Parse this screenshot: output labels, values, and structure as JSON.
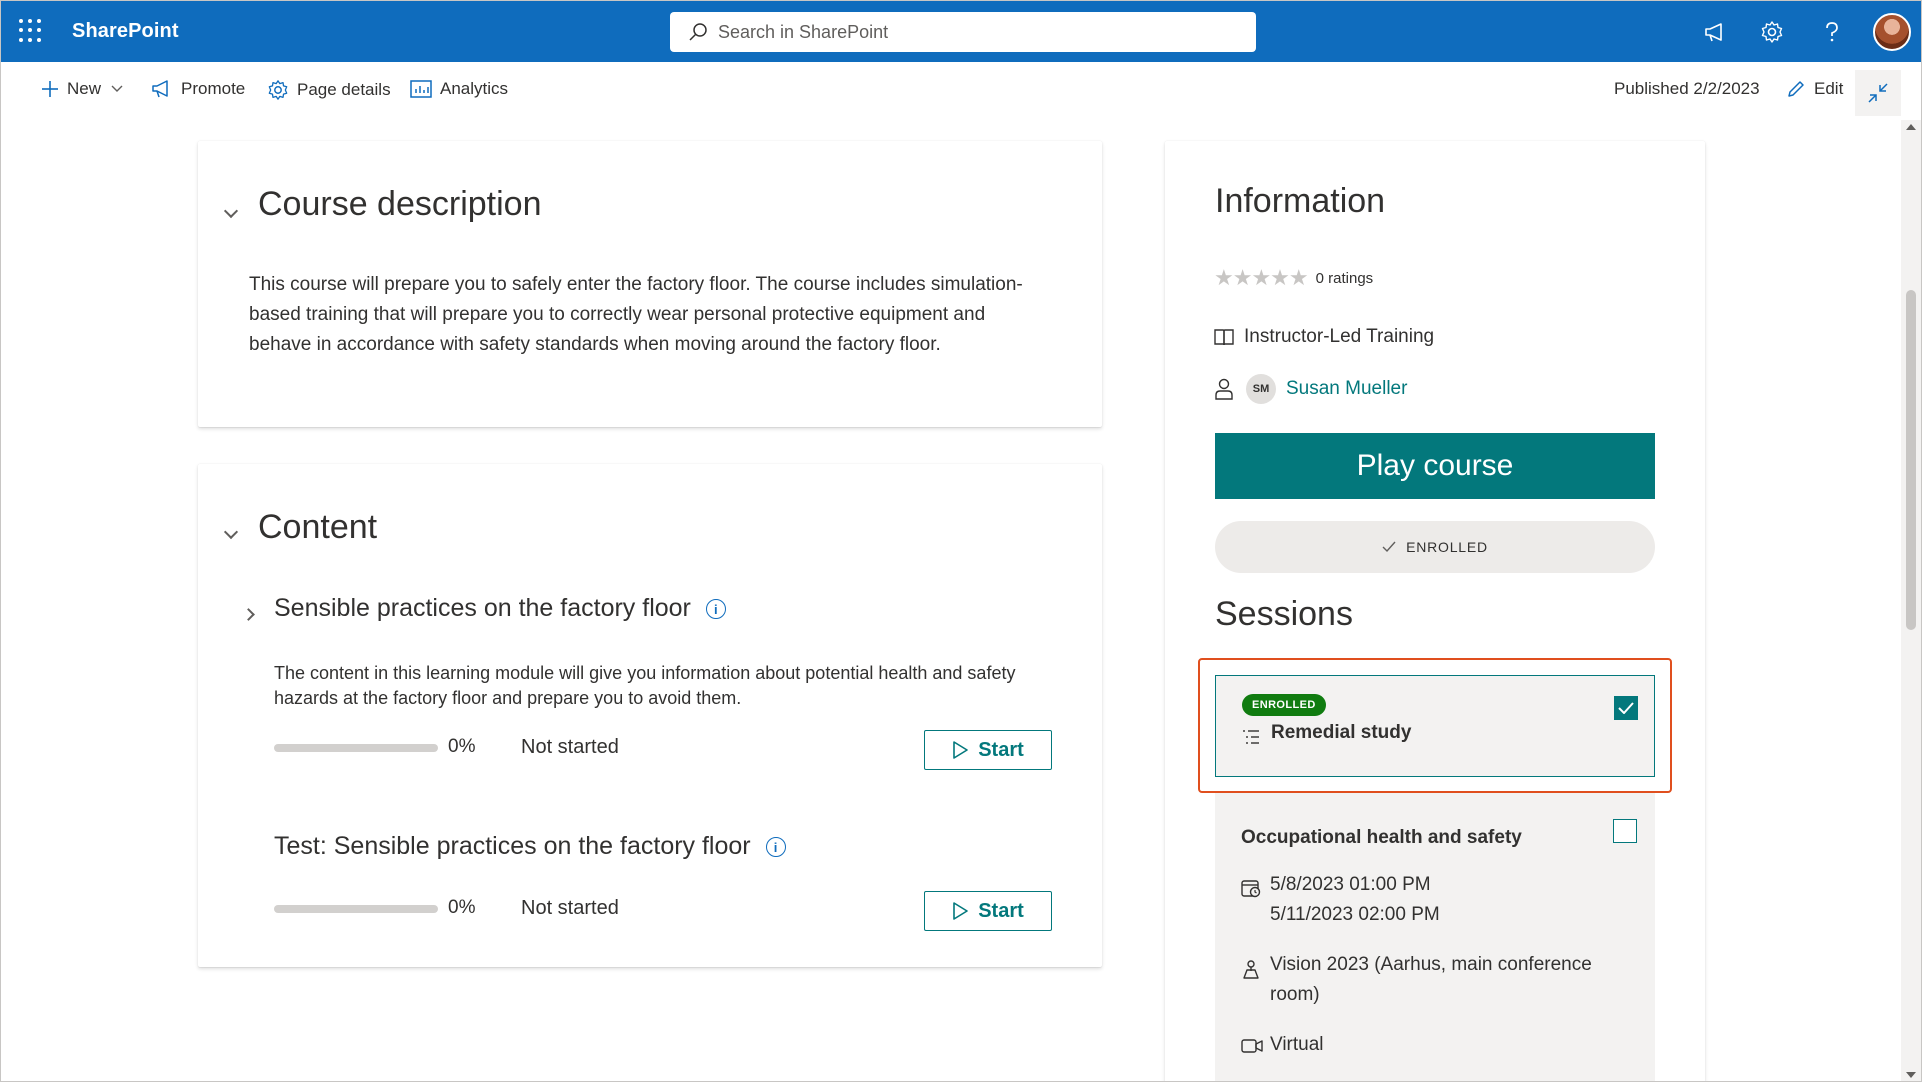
{
  "suitebar": {
    "app_name": "SharePoint",
    "search_placeholder": "Search in SharePoint"
  },
  "commandbar": {
    "new_label": "New",
    "promote_label": "Promote",
    "page_details_label": "Page details",
    "analytics_label": "Analytics",
    "published": "Published 2/2/2023",
    "edit_label": "Edit"
  },
  "course_description": {
    "title": "Course description",
    "text": "This course will prepare you to safely enter the factory floor. The course includes simulation-based training that will prepare you to correctly wear personal protective equipment and behave in accordance with safety standards when moving around the factory floor."
  },
  "content": {
    "title": "Content",
    "modules": [
      {
        "title": "Sensible practices on the factory floor",
        "description": "The content in this learning module will give you information about potential health and safety hazards at the factory floor and prepare you to avoid them.",
        "progress": "0%",
        "status": "Not started",
        "button": "Start"
      },
      {
        "title": "Test: Sensible practices on the factory floor",
        "progress": "0%",
        "status": "Not started",
        "button": "Start"
      }
    ]
  },
  "information": {
    "title": "Information",
    "ratings": "0 ratings",
    "rating_value": 0,
    "rating_max": 5,
    "type": "Instructor-Led Training",
    "instructor_initials": "SM",
    "instructor_name": "Susan Mueller",
    "play_button": "Play course",
    "enrolled_pill": "ENROLLED"
  },
  "sessions": {
    "title": "Sessions",
    "items": [
      {
        "badge": "ENROLLED",
        "name": "Remedial study",
        "checked": true
      },
      {
        "name": "Occupational health and safety",
        "date_start": "5/8/2023 01:00 PM",
        "date_end": "5/11/2023 02:00 PM",
        "location_line1": "Vision 2023 (Aarhus, main conference",
        "location_line2": "room)",
        "mode": "Virtual",
        "checked": false
      }
    ]
  },
  "colors": {
    "suitebar": "#0f6cbd",
    "accent": "#03787c",
    "enrolled_badge": "#107c10",
    "highlight": "#e04f1e"
  }
}
